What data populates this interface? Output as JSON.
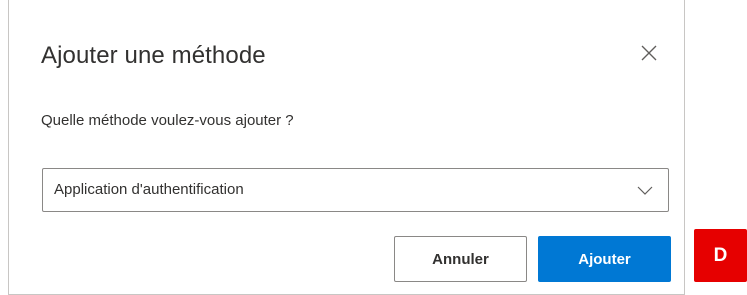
{
  "dialog": {
    "title": "Ajouter une méthode",
    "close_icon": "close-icon",
    "question": "Quelle méthode voulez-vous ajouter ?",
    "method_select": {
      "selected": "Application d'authentification",
      "icon": "chevron-down-icon"
    },
    "buttons": {
      "cancel_label": "Annuler",
      "add_label": "Ajouter"
    }
  },
  "badge": {
    "label": "D",
    "color": "#e60000"
  },
  "colors": {
    "primary": "#0078d4",
    "border": "#8a8886",
    "text": "#323130"
  }
}
